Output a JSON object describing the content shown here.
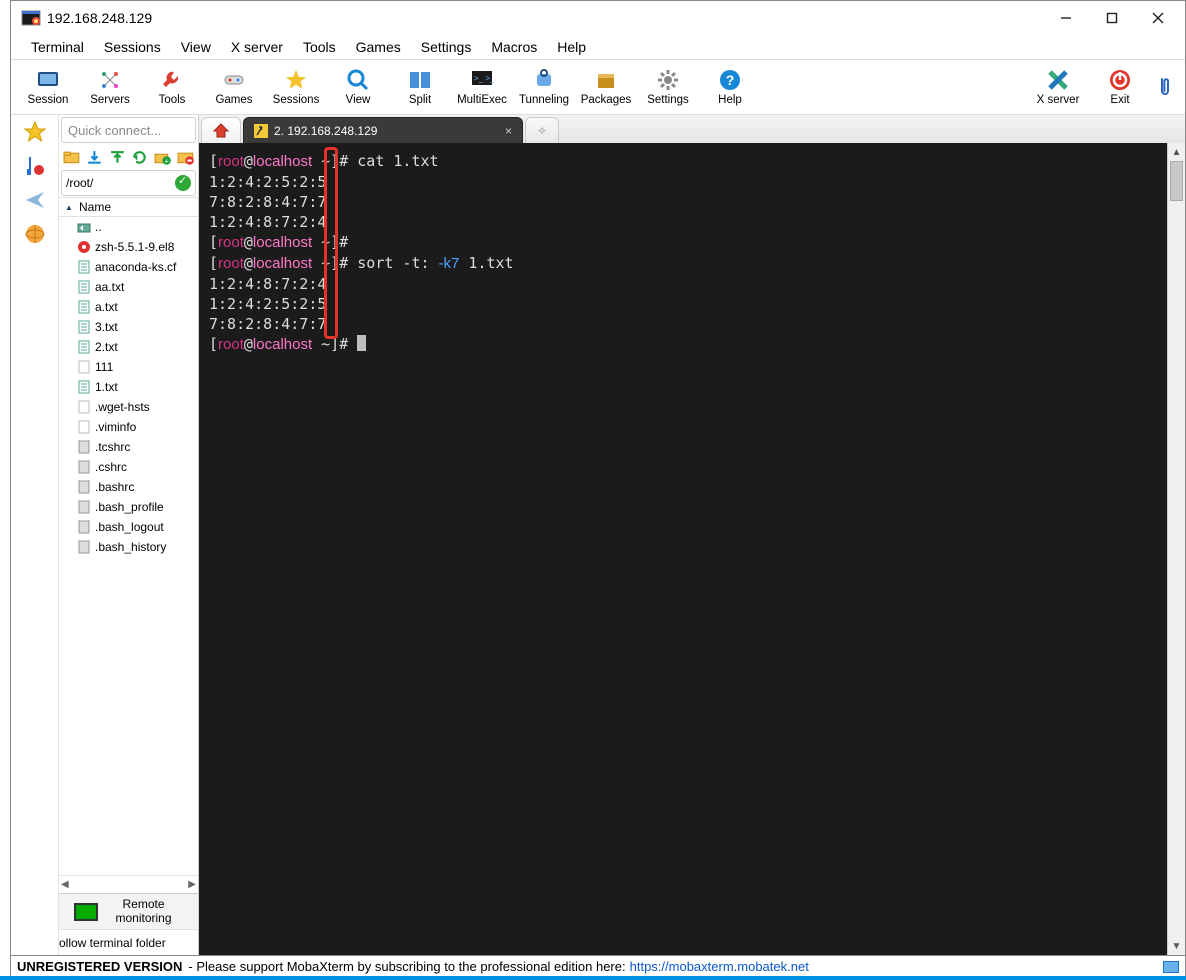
{
  "window": {
    "title": "192.168.248.129"
  },
  "menu": [
    "Terminal",
    "Sessions",
    "View",
    "X server",
    "Tools",
    "Games",
    "Settings",
    "Macros",
    "Help"
  ],
  "toolbar": [
    {
      "label": "Session",
      "ico": "session"
    },
    {
      "label": "Servers",
      "ico": "servers"
    },
    {
      "label": "Tools",
      "ico": "tools"
    },
    {
      "label": "Games",
      "ico": "games"
    },
    {
      "label": "Sessions",
      "ico": "sessions"
    },
    {
      "label": "View",
      "ico": "view"
    },
    {
      "label": "Split",
      "ico": "split"
    },
    {
      "label": "MultiExec",
      "ico": "multiexec"
    },
    {
      "label": "Tunneling",
      "ico": "tunneling"
    },
    {
      "label": "Packages",
      "ico": "packages"
    },
    {
      "label": "Settings",
      "ico": "settings"
    },
    {
      "label": "Help",
      "ico": "help"
    }
  ],
  "toolbar_right": [
    {
      "label": "X server",
      "ico": "xserver"
    },
    {
      "label": "Exit",
      "ico": "exit"
    }
  ],
  "side": {
    "quick_placeholder": "Quick connect...",
    "path": "/root/",
    "hdr": "Name",
    "tree": [
      {
        "name": "..",
        "ico": "up"
      },
      {
        "name": "zsh-5.5.1-9.el8",
        "ico": "rpm"
      },
      {
        "name": "anaconda-ks.cf",
        "ico": "txt"
      },
      {
        "name": "aa.txt",
        "ico": "txt"
      },
      {
        "name": "a.txt",
        "ico": "txt"
      },
      {
        "name": "3.txt",
        "ico": "txt"
      },
      {
        "name": "2.txt",
        "ico": "txt"
      },
      {
        "name": "111",
        "ico": "blank"
      },
      {
        "name": "1.txt",
        "ico": "txt"
      },
      {
        "name": ".wget-hsts",
        "ico": "blank"
      },
      {
        "name": ".viminfo",
        "ico": "blank"
      },
      {
        "name": ".tcshrc",
        "ico": "gray"
      },
      {
        "name": ".cshrc",
        "ico": "gray"
      },
      {
        "name": ".bashrc",
        "ico": "gray"
      },
      {
        "name": ".bash_profile",
        "ico": "gray"
      },
      {
        "name": ".bash_logout",
        "ico": "gray"
      },
      {
        "name": ".bash_history",
        "ico": "gray"
      }
    ],
    "remote_btn": "Remote monitoring",
    "follow": "ollow terminal folder"
  },
  "tabs": {
    "active": "2. 192.168.248.129"
  },
  "terminal": {
    "lines": [
      {
        "t": "prompt",
        "cmd": "cat 1.txt"
      },
      {
        "t": "out",
        "text": "1:2:4:2:5:2:5"
      },
      {
        "t": "out",
        "text": "7:8:2:8:4:7:7"
      },
      {
        "t": "out",
        "text": "1:2:4:8:7:2:4"
      },
      {
        "t": "prompt",
        "cmd": ""
      },
      {
        "t": "prompt",
        "cmd": "sort -t: -k7 1.txt",
        "opt": "-k7"
      },
      {
        "t": "out",
        "text": "1:2:4:8:7:2:4"
      },
      {
        "t": "out",
        "text": "1:2:4:2:5:2:5"
      },
      {
        "t": "out",
        "text": "7:8:2:8:4:7:7"
      },
      {
        "t": "prompt",
        "cmd": "",
        "cursor": true
      }
    ],
    "user": "root",
    "host": "localhost",
    "dir": "~"
  },
  "status": {
    "strong": "UNREGISTERED VERSION",
    "text": " -  Please support MobaXterm by subscribing to the professional edition here:  ",
    "link": "https://mobaxterm.mobatek.net"
  }
}
